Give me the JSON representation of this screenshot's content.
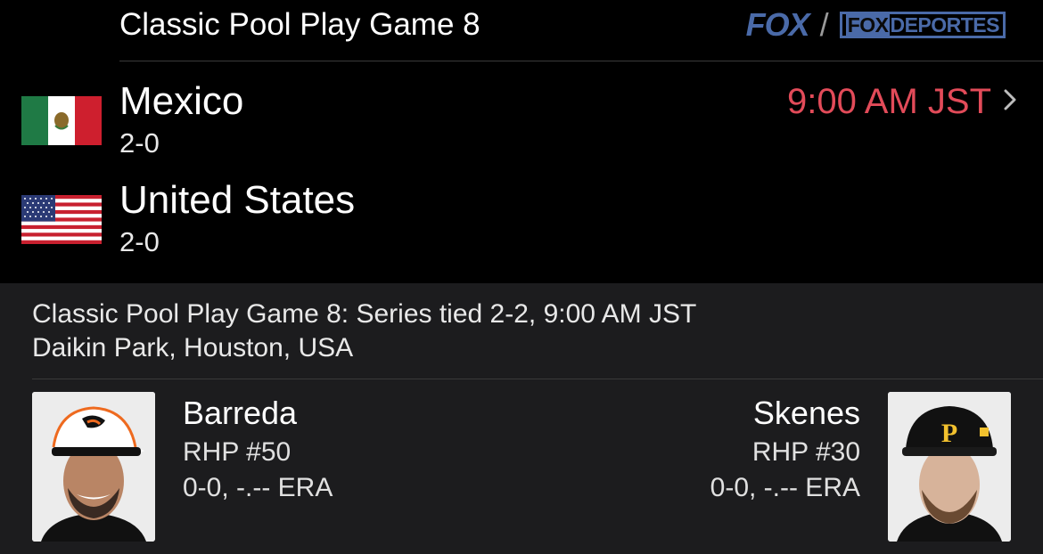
{
  "header": {
    "title": "Classic Pool Play Game 8",
    "networks": {
      "primary": "FOX",
      "separator": "/",
      "secondary_box": "FOX",
      "secondary_rest": "DEPORTES"
    }
  },
  "teams": [
    {
      "name": "Mexico",
      "record": "2-0",
      "flag": "mexico-flag"
    },
    {
      "name": "United States",
      "record": "2-0",
      "flag": "usa-flag"
    }
  ],
  "game_time": "9:00 AM JST",
  "details": {
    "summary": "Classic Pool Play Game 8: Series tied 2-2, 9:00 AM JST",
    "venue": "Daikin Park, Houston, USA"
  },
  "pitchers": {
    "away": {
      "name": "Barreda",
      "position": "RHP #50",
      "stats": "0-0, -.-- ERA"
    },
    "home": {
      "name": "Skenes",
      "position": "RHP #30",
      "stats": "0-0, -.-- ERA"
    }
  },
  "colors": {
    "accent_time": "#e24b59",
    "fox_blue": "#4a6aa8",
    "panel_bg": "#1c1c1e"
  }
}
